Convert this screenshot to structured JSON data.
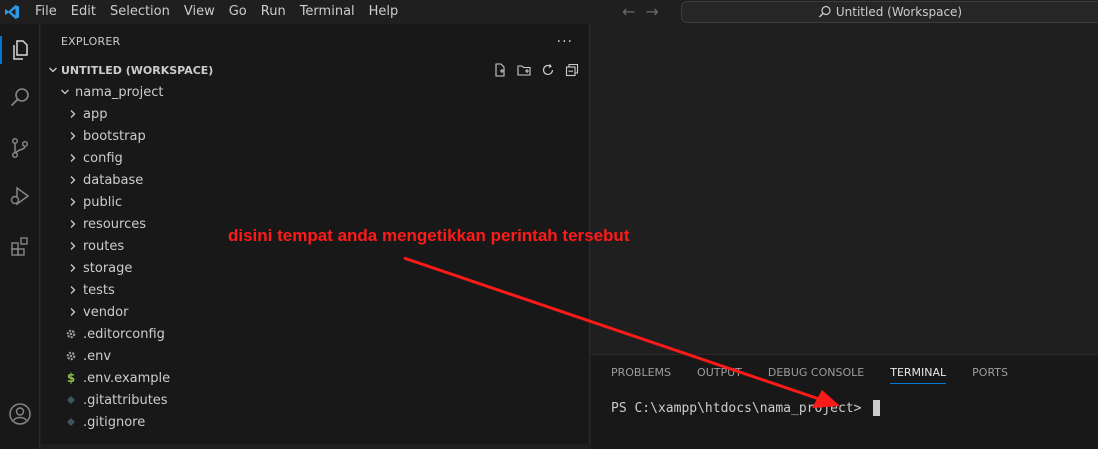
{
  "menu": [
    "File",
    "Edit",
    "Selection",
    "View",
    "Go",
    "Run",
    "Terminal",
    "Help"
  ],
  "command_center": {
    "label": "Untitled (Workspace)"
  },
  "explorer": {
    "title": "EXPLORER",
    "workspace": "UNTITLED (WORKSPACE)",
    "project": "nama_project",
    "folders": [
      "app",
      "bootstrap",
      "config",
      "database",
      "public",
      "resources",
      "routes",
      "storage",
      "tests",
      "vendor"
    ],
    "files": [
      {
        "name": ".editorconfig",
        "icon": "gear-icon"
      },
      {
        "name": ".env",
        "icon": "gear-icon"
      },
      {
        "name": ".env.example",
        "icon": "dollar-icon"
      },
      {
        "name": ".gitattributes",
        "icon": "diamond-icon"
      },
      {
        "name": ".gitignore",
        "icon": "diamond-icon"
      }
    ]
  },
  "panel": {
    "tabs": [
      "PROBLEMS",
      "OUTPUT",
      "DEBUG CONSOLE",
      "TERMINAL",
      "PORTS"
    ],
    "active_tab": "TERMINAL",
    "prompt": "PS C:\\xampp\\htdocs\\nama_project> "
  },
  "annotation": {
    "text": "disini tempat anda mengetikkan perintah tersebut",
    "color": "#ff1a1a"
  },
  "colors": {
    "accent": "#0078d4",
    "background": "#1f1f1f",
    "sidebar": "#181818"
  }
}
